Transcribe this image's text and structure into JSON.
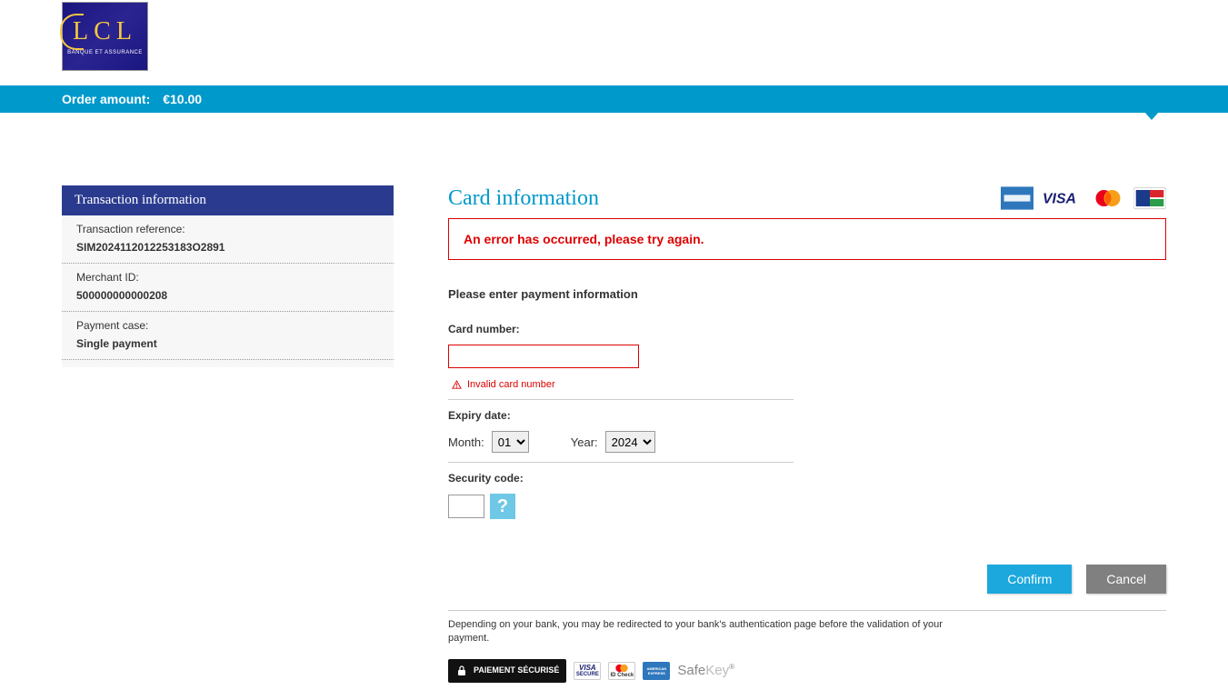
{
  "logo": {
    "text": "LCL",
    "sub": "BANQUE ET ASSURANCE"
  },
  "amount_bar": {
    "label": "Order amount:",
    "value": "€10.00"
  },
  "sidebar": {
    "title": "Transaction information",
    "rows": [
      {
        "label": "Transaction reference:",
        "value": "SIM2024112012253183O2891"
      },
      {
        "label": "Merchant ID:",
        "value": "500000000000208"
      },
      {
        "label": "Payment case:",
        "value": "Single payment"
      }
    ]
  },
  "content": {
    "title": "Card information",
    "error": "An error has occurred, please try again.",
    "intro": "Please enter payment information",
    "card_number": {
      "label": "Card number:",
      "value": "",
      "error": "Invalid card number"
    },
    "expiry": {
      "label": "Expiry date:",
      "month_label": "Month:",
      "month_value": "01",
      "year_label": "Year:",
      "year_value": "2024"
    },
    "security": {
      "label": "Security code:",
      "value": "",
      "help": "?"
    },
    "confirm": "Confirm",
    "cancel": "Cancel",
    "disclaimer": "Depending on your bank, you may be redirected to your bank's authentication page before the validation of your payment.",
    "paysec": "PAIEMENT SÉCURISÉ",
    "visa_secure": "VISA",
    "visa_secure_sub": "SECURE",
    "mc_id": "ID Check",
    "amex_small": "AMERICAN EXPRESS",
    "safekey_a": "Safe",
    "safekey_b": "Key"
  }
}
